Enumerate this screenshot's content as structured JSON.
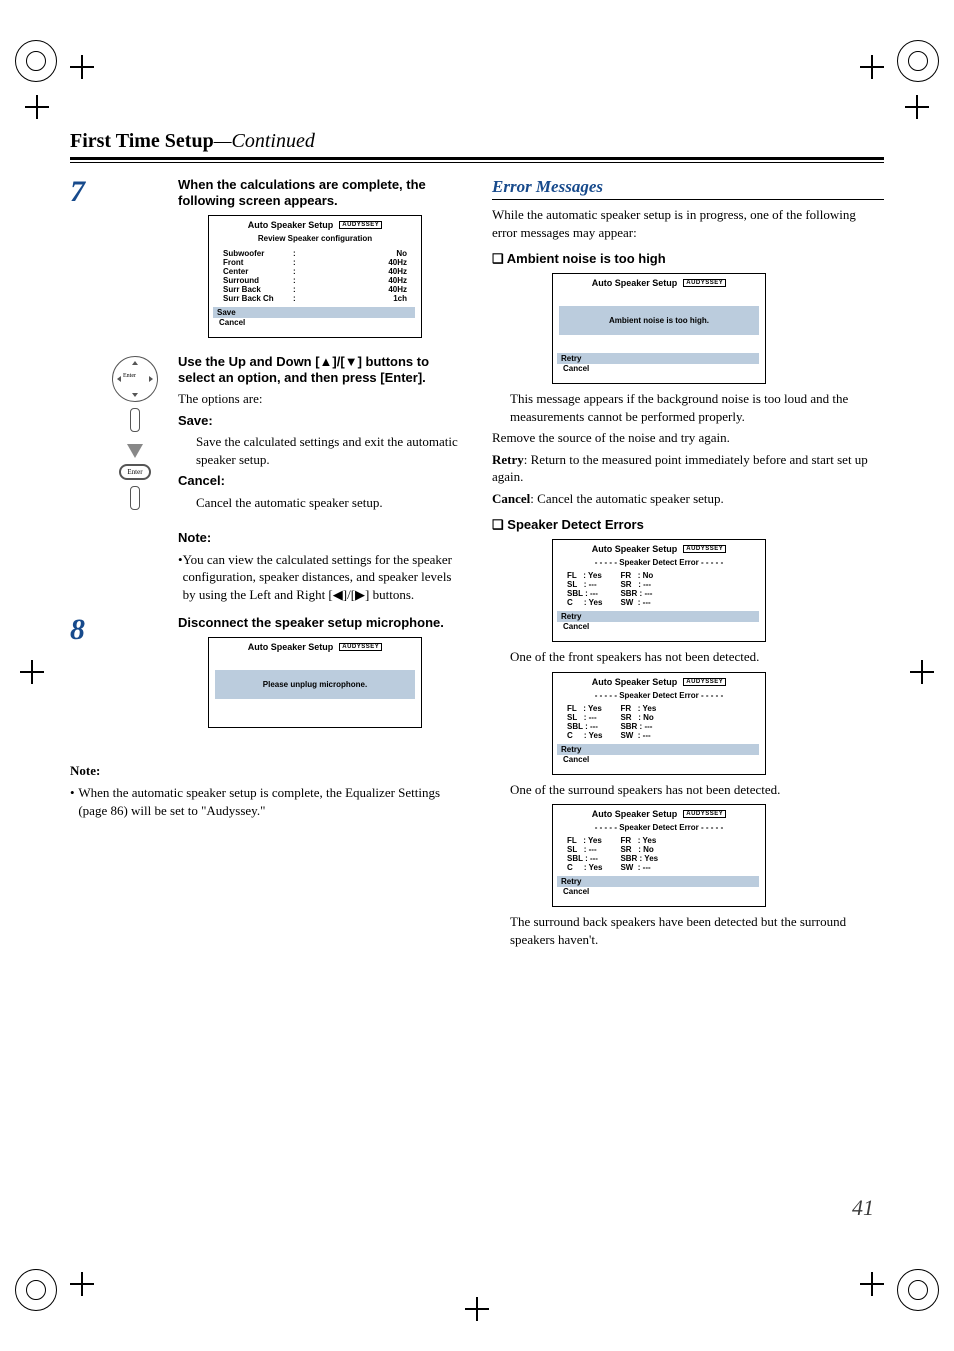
{
  "header": {
    "title_bold": "First Time Setup",
    "title_italic": "—Continued"
  },
  "step7": {
    "num": "7",
    "intro": "When the calculations are complete, the following screen appears.",
    "osd": {
      "title": "Auto Speaker Setup",
      "badge": "AUDYSSEY",
      "subtitle": "Review Speaker configuration",
      "rows": [
        {
          "label": "Subwoofer",
          "value": "No"
        },
        {
          "label": "Front",
          "value": "40Hz"
        },
        {
          "label": "Center",
          "value": "40Hz"
        },
        {
          "label": "Surround",
          "value": "40Hz"
        },
        {
          "label": "Surr Back",
          "value": "40Hz"
        },
        {
          "label": "Surr Back Ch",
          "value": "1ch"
        }
      ],
      "save": "Save",
      "cancel": "Cancel"
    },
    "instr": "Use the Up and Down [▲]/[▼] buttons to select an option, and then press [Enter].",
    "options_lead": "The options are:",
    "save_h": "Save:",
    "save_t": "Save the calculated settings and exit the automatic speaker setup.",
    "cancel_h": "Cancel:",
    "cancel_t": "Cancel the automatic speaker setup.",
    "note_h": "Note:",
    "note_t": "You can view the calculated settings for the speaker configuration, speaker distances, and speaker levels by using the Left and Right [◀]/[▶] buttons."
  },
  "step8": {
    "num": "8",
    "intro": "Disconnect the speaker setup microphone.",
    "osd": {
      "title": "Auto Speaker Setup",
      "badge": "AUDYSSEY",
      "msg": "Please unplug microphone."
    }
  },
  "left_note": {
    "h": "Note:",
    "t": "When the automatic speaker setup is complete, the Equalizer Settings (page 86) will be set to \"Audyssey.\""
  },
  "right": {
    "section": "Error Messages",
    "intro": "While the automatic speaker setup is in progress, one of the following error messages may appear:",
    "amb_h": "Ambient noise is too high",
    "amb_osd": {
      "title": "Auto Speaker Setup",
      "badge": "AUDYSSEY",
      "msg": "Ambient noise is too high.",
      "retry": "Retry",
      "cancel": "Cancel"
    },
    "amb_p1": "This message appears if the background noise is too loud and the measurements cannot be performed properly.",
    "amb_p2": "Remove the source of the noise and try again.",
    "retry_h": "Retry",
    "retry_t": ": Return to the measured point immediately before and start set up again.",
    "cancel_h": "Cancel",
    "cancel_t": ": Cancel the automatic speaker setup.",
    "sde_h": "Speaker Detect Errors",
    "sde_title": "Auto Speaker Setup",
    "sde_badge": "AUDYSSEY",
    "sde_sub": "- - - - - Speaker Detect Error - - - - -",
    "sde_retry": "Retry",
    "sde_cancel": "Cancel",
    "sde1": {
      "left": [
        "FL   : Yes",
        "SL   : ---",
        "SBL : ---",
        "C     : Yes"
      ],
      "right": [
        "FR   : No",
        "SR   : ---",
        "SBR : ---",
        "SW  : ---"
      ],
      "cap": "One of the front speakers has not been detected."
    },
    "sde2": {
      "left": [
        "FL   : Yes",
        "SL   : ---",
        "SBL : ---",
        "C     : Yes"
      ],
      "right": [
        "FR   : Yes",
        "SR   : No",
        "SBR : ---",
        "SW  : ---"
      ],
      "cap": "One of the surround speakers has not been detected."
    },
    "sde3": {
      "left": [
        "FL   : Yes",
        "SL   : ---",
        "SBL : ---",
        "C     : Yes"
      ],
      "right": [
        "FR   : Yes",
        "SR   : No",
        "SBR : Yes",
        "SW  : ---"
      ],
      "cap": "The surround back speakers have been detected but the surround speakers haven't."
    }
  },
  "page_num": "41"
}
